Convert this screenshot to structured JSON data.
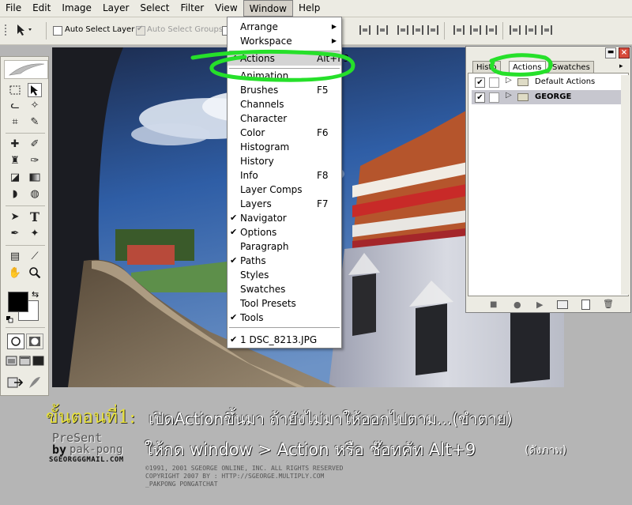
{
  "menubar": {
    "items": [
      "File",
      "Edit",
      "Image",
      "Layer",
      "Select",
      "Filter",
      "View",
      "Window",
      "Help"
    ],
    "active": "Window"
  },
  "options_bar": {
    "auto_select_layer": "Auto Select Layer",
    "auto_select_groups": "Auto Select Groups"
  },
  "window_menu": {
    "items": [
      {
        "label": "Arrange",
        "submenu": true
      },
      {
        "label": "Workspace",
        "submenu": true
      },
      {
        "label": "Actions",
        "shortcut": "Alt+F9",
        "checked": true,
        "highlighted": true
      },
      {
        "label": "Animation"
      },
      {
        "label": "Brushes",
        "shortcut": "F5"
      },
      {
        "label": "Channels"
      },
      {
        "label": "Character"
      },
      {
        "label": "Color",
        "shortcut": "F6"
      },
      {
        "label": "Histogram"
      },
      {
        "label": "History"
      },
      {
        "label": "Info",
        "shortcut": "F8"
      },
      {
        "label": "Layer Comps"
      },
      {
        "label": "Layers",
        "shortcut": "F7"
      },
      {
        "label": "Navigator",
        "checked": true
      },
      {
        "label": "Options",
        "checked": true
      },
      {
        "label": "Paragraph"
      },
      {
        "label": "Paths",
        "checked": true
      },
      {
        "label": "Styles"
      },
      {
        "label": "Swatches"
      },
      {
        "label": "Tool Presets"
      },
      {
        "label": "Tools",
        "checked": true
      },
      {
        "label": "1 DSC_8213.JPG",
        "checked": true
      }
    ]
  },
  "actions_panel": {
    "tabs": [
      "Histo",
      "Actions",
      "Swatches"
    ],
    "active_tab": "Actions",
    "rows": [
      {
        "name": "Default Actions",
        "checked": true
      },
      {
        "name": "GEORGE",
        "checked": true,
        "selected": true
      }
    ]
  },
  "overlay": {
    "step_title": "ขั้นตอนที่1:",
    "step_text": "เปิดActionขึ้นมา ถ้ายังไม่มาให้ออกไปตาม...(ขำตาย)",
    "instruction": "ให้กด window > Action หรือ ช๊อทคัท Alt+9",
    "instruction_suffix": "(ดังภาพ)",
    "present_line1": "PreSent",
    "present_line2": "by",
    "present_name": "pak-pong",
    "site": "SGEORGGGMAIL.COM",
    "copyright1": "©1991, 2001 SGEORGE ONLINE, INC. ALL RIGHTS RESERVED",
    "copyright2": "COPYRIGHT 2007 BY : HTTP://SGEORGE.MULTIPLY.COM",
    "copyright3": "_PAKPONG PONGATCHAT"
  },
  "colors": {
    "chrome": "#ecebe3",
    "menu_highlight": "#d4d4d4",
    "annotation_green": "#22dd22",
    "overlay_yellow": "#e8e13a"
  }
}
